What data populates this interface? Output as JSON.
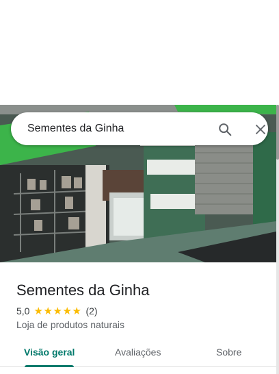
{
  "search": {
    "value": "Sementes da Ginha",
    "search_icon": "search-icon",
    "close_icon": "close-icon"
  },
  "place": {
    "name": "Sementes da Ginha",
    "rating": "5,0",
    "stars": [
      "★",
      "★",
      "★",
      "★",
      "★"
    ],
    "review_count": "(2)",
    "category": "Loja de produtos naturais"
  },
  "tabs": [
    {
      "label": "Visão geral",
      "active": true
    },
    {
      "label": "Avaliações",
      "active": false
    },
    {
      "label": "Sobre",
      "active": false
    }
  ],
  "colors": {
    "accent": "#00796b",
    "star": "#fbbc04",
    "awning_green": "#3cb44a"
  }
}
